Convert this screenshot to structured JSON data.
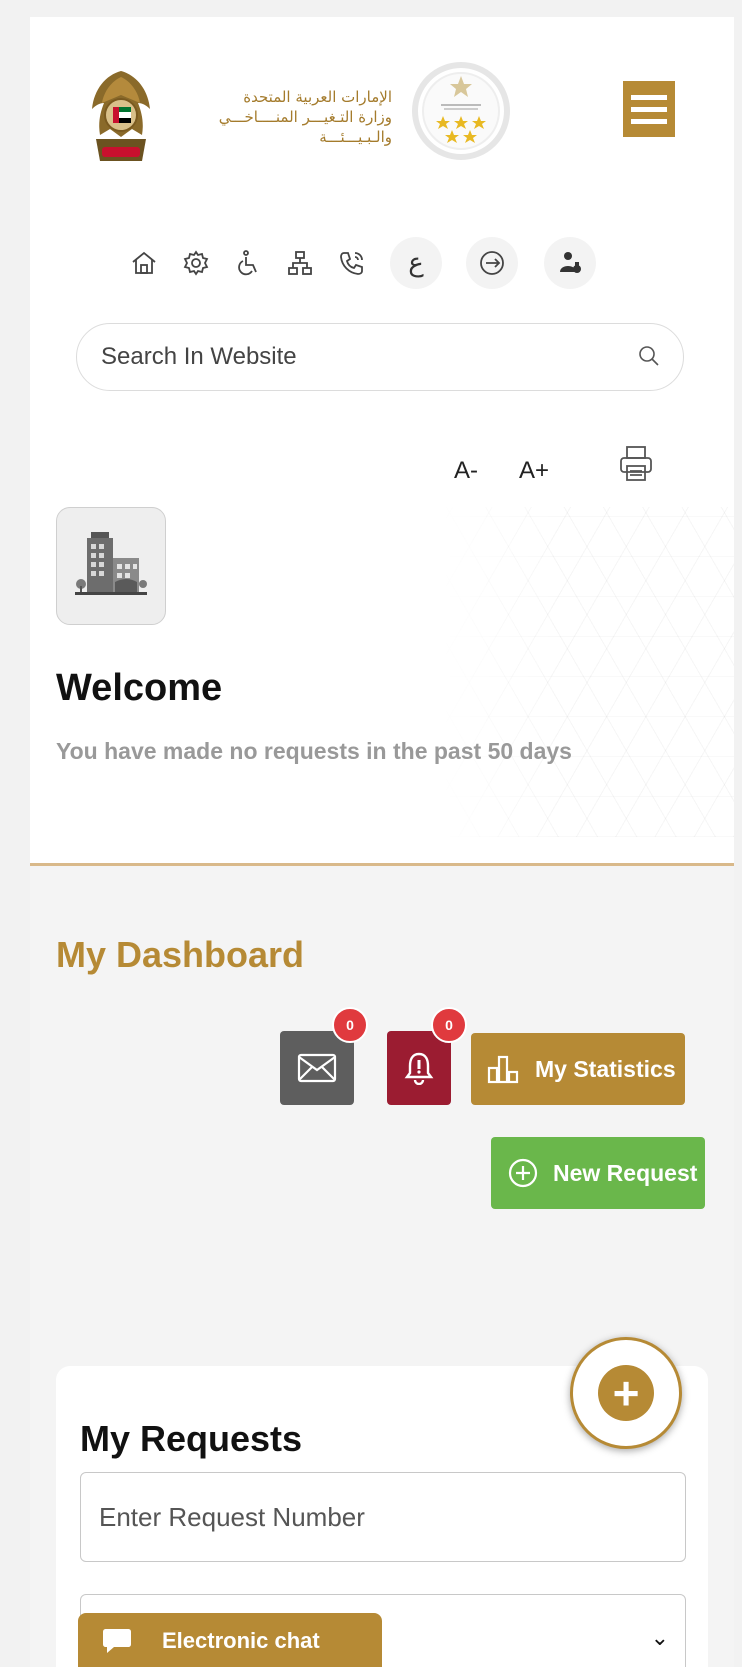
{
  "header": {
    "ministry_line1": "الإمارات العربية المتحدة",
    "ministry_line2": "وزارة التـغيـــر المنــــاخـــي",
    "ministry_line3": "والـبـيـــئـــة",
    "menu_icon": "hamburger-icon"
  },
  "toolbar": {
    "icons": [
      "home-icon",
      "settings-icon",
      "accessibility-icon",
      "sitemap-icon",
      "phone-icon",
      "arabic-language-icon",
      "logout-icon",
      "user-profile-icon"
    ],
    "arabic_label": "ع"
  },
  "search": {
    "placeholder": "Search In Website"
  },
  "font_controls": {
    "decrease": "A-",
    "increase": "A+"
  },
  "welcome": {
    "title": "Welcome",
    "subtitle": "You have made no requests in the past 50 days"
  },
  "dashboard": {
    "title": "My Dashboard",
    "messages_count": "0",
    "notifications_count": "0",
    "statistics_label": "My Statistics",
    "new_request_label": "New Request"
  },
  "requests": {
    "title": "My Requests",
    "number_placeholder": "Enter Request Number"
  },
  "chat": {
    "label": "Electronic chat"
  },
  "colors": {
    "gold": "#b68a35",
    "green": "#6ab74b",
    "maroon": "#9b1c31",
    "gray_button": "#5e5e5e",
    "badge_red": "#e03a3e"
  }
}
